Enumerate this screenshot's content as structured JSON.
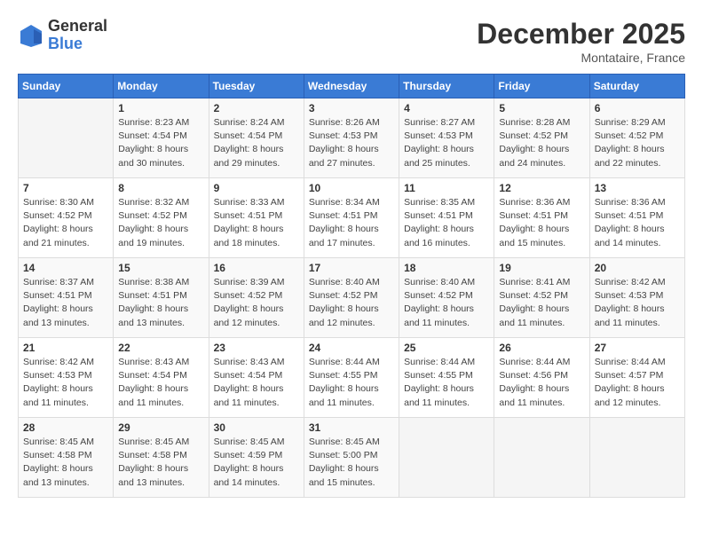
{
  "logo": {
    "general": "General",
    "blue": "Blue"
  },
  "title": "December 2025",
  "subtitle": "Montataire, France",
  "days_header": [
    "Sunday",
    "Monday",
    "Tuesday",
    "Wednesday",
    "Thursday",
    "Friday",
    "Saturday"
  ],
  "weeks": [
    [
      {
        "day": "",
        "info": ""
      },
      {
        "day": "1",
        "info": "Sunrise: 8:23 AM\nSunset: 4:54 PM\nDaylight: 8 hours\nand 30 minutes."
      },
      {
        "day": "2",
        "info": "Sunrise: 8:24 AM\nSunset: 4:54 PM\nDaylight: 8 hours\nand 29 minutes."
      },
      {
        "day": "3",
        "info": "Sunrise: 8:26 AM\nSunset: 4:53 PM\nDaylight: 8 hours\nand 27 minutes."
      },
      {
        "day": "4",
        "info": "Sunrise: 8:27 AM\nSunset: 4:53 PM\nDaylight: 8 hours\nand 25 minutes."
      },
      {
        "day": "5",
        "info": "Sunrise: 8:28 AM\nSunset: 4:52 PM\nDaylight: 8 hours\nand 24 minutes."
      },
      {
        "day": "6",
        "info": "Sunrise: 8:29 AM\nSunset: 4:52 PM\nDaylight: 8 hours\nand 22 minutes."
      }
    ],
    [
      {
        "day": "7",
        "info": "Sunrise: 8:30 AM\nSunset: 4:52 PM\nDaylight: 8 hours\nand 21 minutes."
      },
      {
        "day": "8",
        "info": "Sunrise: 8:32 AM\nSunset: 4:52 PM\nDaylight: 8 hours\nand 19 minutes."
      },
      {
        "day": "9",
        "info": "Sunrise: 8:33 AM\nSunset: 4:51 PM\nDaylight: 8 hours\nand 18 minutes."
      },
      {
        "day": "10",
        "info": "Sunrise: 8:34 AM\nSunset: 4:51 PM\nDaylight: 8 hours\nand 17 minutes."
      },
      {
        "day": "11",
        "info": "Sunrise: 8:35 AM\nSunset: 4:51 PM\nDaylight: 8 hours\nand 16 minutes."
      },
      {
        "day": "12",
        "info": "Sunrise: 8:36 AM\nSunset: 4:51 PM\nDaylight: 8 hours\nand 15 minutes."
      },
      {
        "day": "13",
        "info": "Sunrise: 8:36 AM\nSunset: 4:51 PM\nDaylight: 8 hours\nand 14 minutes."
      }
    ],
    [
      {
        "day": "14",
        "info": "Sunrise: 8:37 AM\nSunset: 4:51 PM\nDaylight: 8 hours\nand 13 minutes."
      },
      {
        "day": "15",
        "info": "Sunrise: 8:38 AM\nSunset: 4:51 PM\nDaylight: 8 hours\nand 13 minutes."
      },
      {
        "day": "16",
        "info": "Sunrise: 8:39 AM\nSunset: 4:52 PM\nDaylight: 8 hours\nand 12 minutes."
      },
      {
        "day": "17",
        "info": "Sunrise: 8:40 AM\nSunset: 4:52 PM\nDaylight: 8 hours\nand 12 minutes."
      },
      {
        "day": "18",
        "info": "Sunrise: 8:40 AM\nSunset: 4:52 PM\nDaylight: 8 hours\nand 11 minutes."
      },
      {
        "day": "19",
        "info": "Sunrise: 8:41 AM\nSunset: 4:52 PM\nDaylight: 8 hours\nand 11 minutes."
      },
      {
        "day": "20",
        "info": "Sunrise: 8:42 AM\nSunset: 4:53 PM\nDaylight: 8 hours\nand 11 minutes."
      }
    ],
    [
      {
        "day": "21",
        "info": "Sunrise: 8:42 AM\nSunset: 4:53 PM\nDaylight: 8 hours\nand 11 minutes."
      },
      {
        "day": "22",
        "info": "Sunrise: 8:43 AM\nSunset: 4:54 PM\nDaylight: 8 hours\nand 11 minutes."
      },
      {
        "day": "23",
        "info": "Sunrise: 8:43 AM\nSunset: 4:54 PM\nDaylight: 8 hours\nand 11 minutes."
      },
      {
        "day": "24",
        "info": "Sunrise: 8:44 AM\nSunset: 4:55 PM\nDaylight: 8 hours\nand 11 minutes."
      },
      {
        "day": "25",
        "info": "Sunrise: 8:44 AM\nSunset: 4:55 PM\nDaylight: 8 hours\nand 11 minutes."
      },
      {
        "day": "26",
        "info": "Sunrise: 8:44 AM\nSunset: 4:56 PM\nDaylight: 8 hours\nand 11 minutes."
      },
      {
        "day": "27",
        "info": "Sunrise: 8:44 AM\nSunset: 4:57 PM\nDaylight: 8 hours\nand 12 minutes."
      }
    ],
    [
      {
        "day": "28",
        "info": "Sunrise: 8:45 AM\nSunset: 4:58 PM\nDaylight: 8 hours\nand 13 minutes."
      },
      {
        "day": "29",
        "info": "Sunrise: 8:45 AM\nSunset: 4:58 PM\nDaylight: 8 hours\nand 13 minutes."
      },
      {
        "day": "30",
        "info": "Sunrise: 8:45 AM\nSunset: 4:59 PM\nDaylight: 8 hours\nand 14 minutes."
      },
      {
        "day": "31",
        "info": "Sunrise: 8:45 AM\nSunset: 5:00 PM\nDaylight: 8 hours\nand 15 minutes."
      },
      {
        "day": "",
        "info": ""
      },
      {
        "day": "",
        "info": ""
      },
      {
        "day": "",
        "info": ""
      }
    ]
  ]
}
